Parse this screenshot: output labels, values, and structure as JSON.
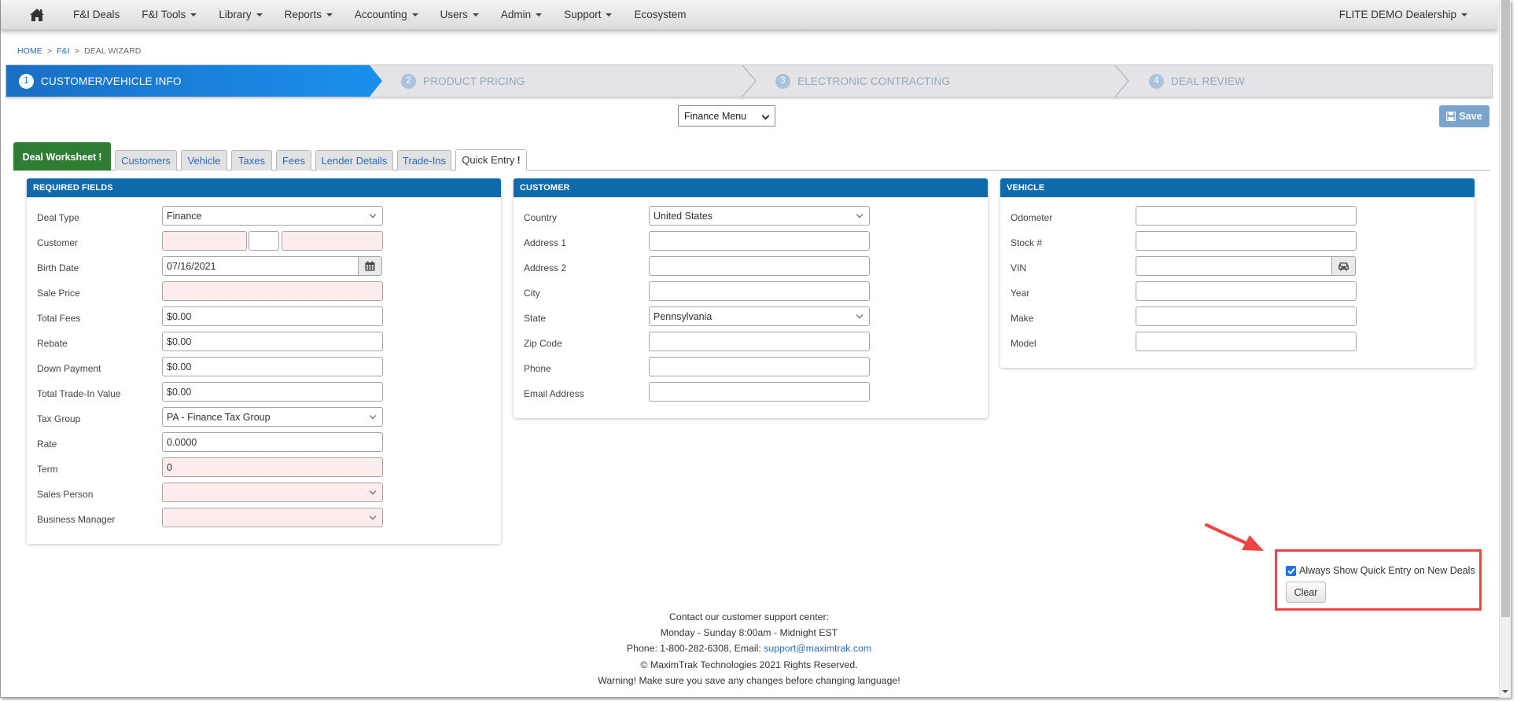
{
  "nav": {
    "home_icon": "home-icon",
    "items": [
      {
        "label": "F&I Deals",
        "dropdown": false
      },
      {
        "label": "F&I Tools",
        "dropdown": true
      },
      {
        "label": "Library",
        "dropdown": true
      },
      {
        "label": "Reports",
        "dropdown": true
      },
      {
        "label": "Accounting",
        "dropdown": true
      },
      {
        "label": "Users",
        "dropdown": true
      },
      {
        "label": "Admin",
        "dropdown": true
      },
      {
        "label": "Support",
        "dropdown": true
      },
      {
        "label": "Ecosystem",
        "dropdown": false
      }
    ],
    "dealership": "FLITE DEMO Dealership"
  },
  "breadcrumb": {
    "items": [
      "HOME",
      "F&I",
      "DEAL WIZARD"
    ],
    "separator": ">"
  },
  "wizard": {
    "steps": [
      {
        "num": "1",
        "label": "CUSTOMER/VEHICLE INFO",
        "active": true
      },
      {
        "num": "2",
        "label": "PRODUCT PRICING",
        "active": false
      },
      {
        "num": "3",
        "label": "ELECTRONIC CONTRACTING",
        "active": false
      },
      {
        "num": "4",
        "label": "DEAL REVIEW",
        "active": false
      }
    ],
    "active_color": "#1f7bd2"
  },
  "toolbar": {
    "menu_select": "Finance Menu",
    "save_label": "Save",
    "save_icon": "floppy-disk-icon"
  },
  "tabs": [
    {
      "label": "Deal Worksheet",
      "alert": "!"
    },
    {
      "label": "Customers"
    },
    {
      "label": "Vehicle"
    },
    {
      "label": "Taxes"
    },
    {
      "label": "Fees"
    },
    {
      "label": "Lender Details"
    },
    {
      "label": "Trade-Ins"
    },
    {
      "label": "Quick Entry",
      "alert": "!"
    }
  ],
  "panels": {
    "required": {
      "title": "REQUIRED FIELDS",
      "fields": {
        "deal_type": {
          "label": "Deal Type",
          "value": "Finance"
        },
        "customer": {
          "label": "Customer",
          "first": "",
          "middle": "",
          "last": ""
        },
        "birth_date": {
          "label": "Birth Date",
          "value": "07/16/2021"
        },
        "sale_price": {
          "label": "Sale Price",
          "value": ""
        },
        "total_fees": {
          "label": "Total Fees",
          "value": "$0.00"
        },
        "rebate": {
          "label": "Rebate",
          "value": "$0.00"
        },
        "down_payment": {
          "label": "Down Payment",
          "value": "$0.00"
        },
        "trade_in": {
          "label": "Total Trade-In Value",
          "value": "$0.00"
        },
        "tax_group": {
          "label": "Tax Group",
          "value": "PA - Finance Tax Group"
        },
        "rate": {
          "label": "Rate",
          "value": "0.0000"
        },
        "term": {
          "label": "Term",
          "value": "0"
        },
        "sales_person": {
          "label": "Sales Person",
          "value": ""
        },
        "business_manager": {
          "label": "Business Manager",
          "value": ""
        }
      }
    },
    "customer": {
      "title": "CUSTOMER",
      "fields": {
        "country": {
          "label": "Country",
          "value": "United States"
        },
        "address1": {
          "label": "Address 1",
          "value": ""
        },
        "address2": {
          "label": "Address 2",
          "value": ""
        },
        "city": {
          "label": "City",
          "value": ""
        },
        "state": {
          "label": "State",
          "value": "Pennsylvania"
        },
        "zip": {
          "label": "Zip Code",
          "value": ""
        },
        "phone": {
          "label": "Phone",
          "value": ""
        },
        "email": {
          "label": "Email Address",
          "value": ""
        }
      }
    },
    "vehicle": {
      "title": "VEHICLE",
      "fields": {
        "odometer": {
          "label": "Odometer",
          "value": ""
        },
        "stock": {
          "label": "Stock #",
          "value": ""
        },
        "vin": {
          "label": "VIN",
          "value": ""
        },
        "year": {
          "label": "Year",
          "value": ""
        },
        "make": {
          "label": "Make",
          "value": ""
        },
        "model": {
          "label": "Model",
          "value": ""
        }
      }
    }
  },
  "quick_entry": {
    "checkbox_label": "Always Show Quick Entry on New Deals",
    "checked": true,
    "clear_label": "Clear",
    "highlight_color": "#ef4444"
  },
  "footer": {
    "line1": "Contact our customer support center:",
    "line2": "Monday - Sunday 8:00am - Midnight EST",
    "phone_prefix": "Phone: 1-800-282-6308, Email: ",
    "email": "support@maximtrak.com",
    "line4": "© MaximTrak Technologies 2021 Rights Reserved.",
    "line5": "Warning! Make sure you save any changes before changing language!"
  }
}
